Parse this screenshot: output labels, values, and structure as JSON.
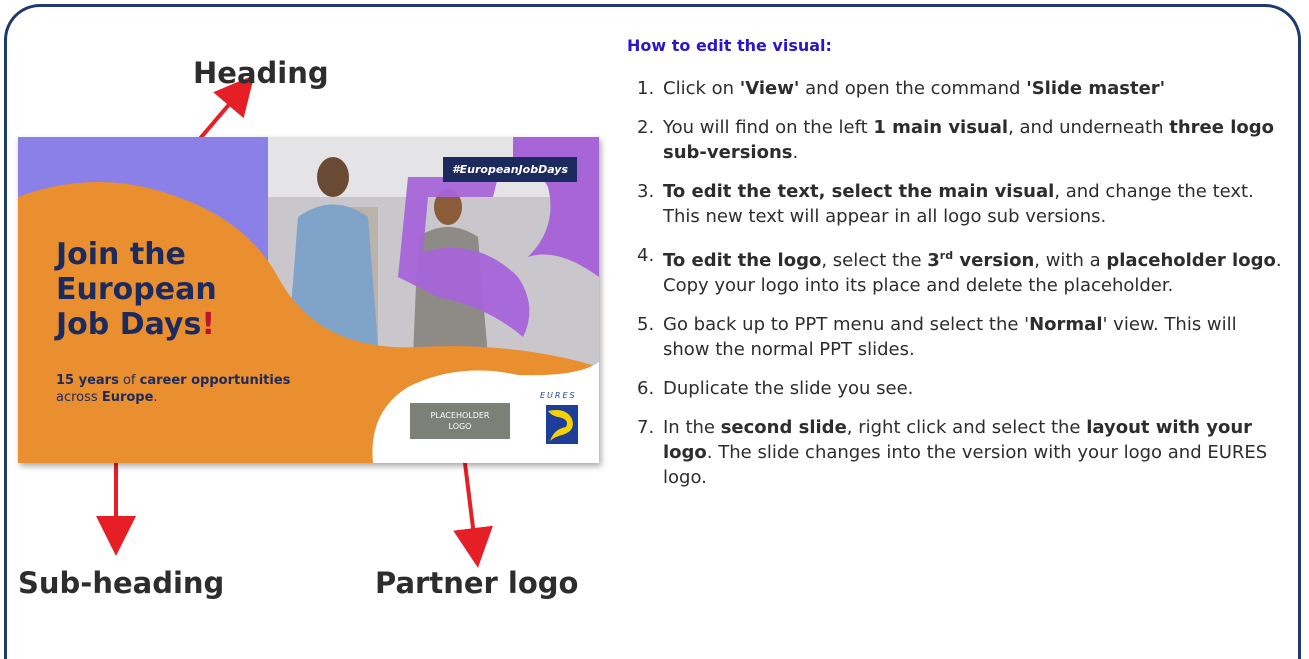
{
  "callouts": {
    "heading": "Heading",
    "sub_heading": "Sub-heading",
    "partner_logo": "Partner logo"
  },
  "slide": {
    "title_line1": "Join the",
    "title_line2": "European",
    "title_line3": "Job Days",
    "title_excl": "!",
    "sub_part1": "15 years",
    "sub_part2": " of ",
    "sub_part3": "career opportunities",
    "sub_part4": "across ",
    "sub_part5": "Europe",
    "sub_part6": ".",
    "hashtag": "#EuropeanJobDays",
    "placeholder_line1": "PLACEHOLDER",
    "placeholder_line2": "LOGO",
    "eures_text": "EURES",
    "colors": {
      "purple": "#8b7fe8",
      "orange": "#ea8f2f",
      "navy": "#1d2a5e",
      "violet": "#a765d8"
    }
  },
  "instructions": {
    "title": "How to edit the visual:",
    "steps": [
      {
        "num": "1.",
        "t1": "Click on ",
        "b1": "'View'",
        "t2": " and open the command ",
        "b2": "'Slide master'"
      },
      {
        "num": "2.",
        "t1": "You will find on the left ",
        "b1": "1 main visual",
        "t2": ", and underneath ",
        "b2": "three logo sub-versions",
        "t3": "."
      },
      {
        "num": "3.",
        "b1": "To edit the text, select the main visual",
        "t1": ", and change the text. This new text will appear in all logo sub versions."
      },
      {
        "num": "4.",
        "b1": "To edit the logo",
        "t1": ", select the ",
        "b2": "3",
        "sup": "rd",
        "b3": " version",
        "t2": ", with a ",
        "b4": "placeholder logo",
        "t3": ". Copy your logo into its place and delete the placeholder."
      },
      {
        "num": "5.",
        "t1": "Go back up to PPT menu and select the '",
        "b1": "Normal",
        "t2": "' view. This will show the normal PPT slides."
      },
      {
        "num": "6.",
        "t1": "Duplicate the slide you see."
      },
      {
        "num": "7.",
        "t1": "In the ",
        "b1": "second slide",
        "t2": ", right click and select the ",
        "b2": "layout with your logo",
        "t3": ". The slide changes into the version with your logo and EURES logo."
      }
    ]
  }
}
